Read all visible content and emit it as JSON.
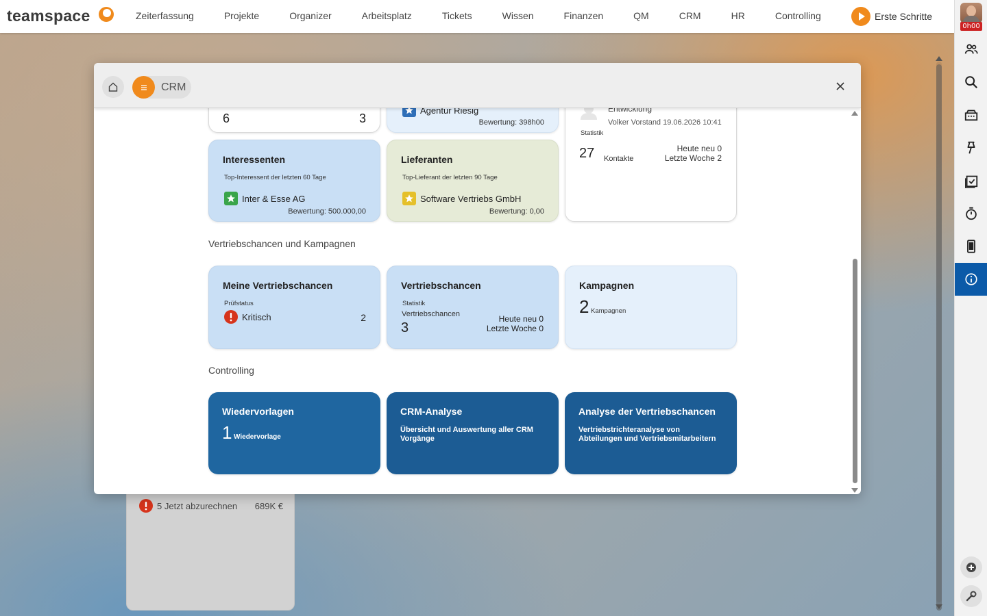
{
  "app": {
    "logo_text": "teamspace"
  },
  "nav": [
    {
      "label": "Zeiterfassung"
    },
    {
      "label": "Projekte"
    },
    {
      "label": "Organizer"
    },
    {
      "label": "Arbeitsplatz"
    },
    {
      "label": "Tickets"
    },
    {
      "label": "Wissen"
    },
    {
      "label": "Finanzen"
    },
    {
      "label": "QM"
    },
    {
      "label": "CRM"
    },
    {
      "label": "HR"
    },
    {
      "label": "Controlling"
    }
  ],
  "first_steps": {
    "label": "Erste Schritte"
  },
  "user": {
    "time_badge": "0h00"
  },
  "sidebar_icons": [
    "people-icon",
    "search-icon",
    "inbox-icon",
    "pin-icon",
    "calendar-check-icon",
    "stopwatch-icon",
    "mobile-icon",
    "info-icon"
  ],
  "background_card": {
    "item_text": "5 Jetzt abzurechnen",
    "amount": "689K €"
  },
  "dialog": {
    "breadcrumb": "CRM",
    "top_row": {
      "card1": {
        "left_num": "6",
        "right_num": "3"
      },
      "card2": {
        "name": "Agentur Riesig",
        "rating": "Bewertung: 398h00"
      },
      "card3": {
        "name": "Entwicklung",
        "meta": "Volker Vorstand 19.06.2026 10:41",
        "stat_label": "Statistik",
        "count": "27",
        "count_label": "Kontakte",
        "today": "Heute neu 0",
        "last_week": "Letzte Woche 2"
      }
    },
    "interessenten": {
      "title": "Interessenten",
      "subtitle": "Top-Interessent der letzten 60 Tage",
      "name": "Inter & Esse AG",
      "rating": "Bewertung: 500.000,00"
    },
    "lieferanten": {
      "title": "Lieferanten",
      "subtitle": "Top-Lieferant der letzten 90 Tage",
      "name": "Software Vertriebs GmbH",
      "rating": "Bewertung: 0,00"
    },
    "section_sales": "Vertriebschancen und Kampagnen",
    "meine_vc": {
      "title": "Meine Vertriebschancen",
      "subtitle": "Prüfstatus",
      "status": "Kritisch",
      "count": "2"
    },
    "vc": {
      "title": "Vertriebschancen",
      "stat_label": "Statistik",
      "label": "Vertriebschancen",
      "count": "3",
      "today": "Heute neu 0",
      "last_week": "Letzte Woche 0"
    },
    "kampagnen": {
      "title": "Kampagnen",
      "count": "2",
      "unit": "Kampagnen"
    },
    "section_controlling": "Controlling",
    "wiedervorlagen": {
      "title": "Wiedervorlagen",
      "count": "1",
      "unit": "Wiedervorlage"
    },
    "crm_analyse": {
      "title": "CRM-Analyse",
      "desc": "Übersicht und Auswertung aller CRM Vorgänge"
    },
    "analyse_vc": {
      "title": "Analyse der Vertriebschancen",
      "desc": "Vertriebstrichteranalyse von Abteilungen und Vertriebsmitarbeitern"
    }
  },
  "colors": {
    "accent": "#f08a1c",
    "active_sidebar": "#0b5aa8",
    "controlling_tile": "#1c5c94",
    "critical": "#d6341c"
  }
}
